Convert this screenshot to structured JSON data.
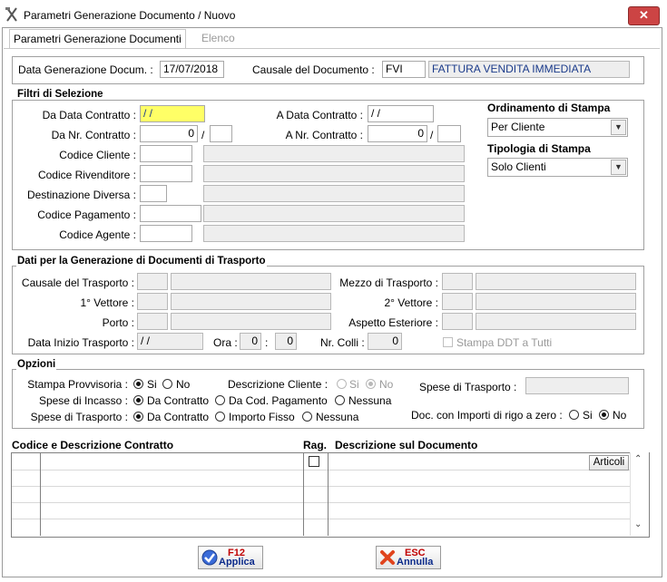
{
  "window": {
    "title": "Parametri Generazione Documento / Nuovo",
    "close_label": "✕"
  },
  "tabs": [
    "Parametri Generazione Documenti",
    "Elenco"
  ],
  "header": {
    "data_gen_label": "Data Generazione Docum. :",
    "data_gen_value": "17/07/2018",
    "causale_label": "Causale del Documento :",
    "causale_code": "FVI",
    "causale_desc": "FATTURA VENDITA IMMEDIATA"
  },
  "filtri": {
    "title": "Filtri di Selezione",
    "da_data_label": "Da Data Contratto :",
    "da_data_value": "/ /",
    "a_data_label": "A Data Contratto :",
    "a_data_value": "/ /",
    "da_nr_label": "Da Nr. Contratto :",
    "da_nr_value": "0",
    "a_nr_label": "A Nr. Contratto :",
    "a_nr_value": "0",
    "slash": "/",
    "codice_cliente_label": "Codice Cliente :",
    "codice_rivenditore_label": "Codice Rivenditore :",
    "destinazione_label": "Destinazione Diversa :",
    "codice_pagamento_label": "Codice Pagamento :",
    "codice_agente_label": "Codice Agente :",
    "ordinamento_label": "Ordinamento di Stampa",
    "ordinamento_value": "Per Cliente",
    "tipologia_label": "Tipologia di Stampa",
    "tipologia_value": "Solo Clienti"
  },
  "trasporto": {
    "title": "Dati per la Generazione di Documenti di Trasporto",
    "causale_label": "Causale del Trasporto :",
    "vettore1_label": "1° Vettore :",
    "porto_label": "Porto :",
    "mezzo_label": "Mezzo di Trasporto :",
    "vettore2_label": "2° Vettore :",
    "aspetto_label": "Aspetto Esteriore :",
    "data_inizio_label": "Data Inizio Trasporto :",
    "data_inizio_value": "/ /",
    "ora_label": "Ora :",
    "ora_h": "0",
    "ora_sep": ":",
    "ora_m": "0",
    "colli_label": "Nr. Colli :",
    "colli_value": "0",
    "stampa_ddt_label": "Stampa DDT a Tutti"
  },
  "opzioni": {
    "title": "Opzioni",
    "stampa_prov_label": "Stampa Provvisoria :",
    "si": "Si",
    "no": "No",
    "descr_cliente_label": "Descrizione Cliente :",
    "spese_trasp_label": "Spese di Trasporto :",
    "spese_incasso_label": "Spese di Incasso :",
    "da_contratto": "Da Contratto",
    "da_cod_pag": "Da Cod. Pagamento",
    "nessuna": "Nessuna",
    "spese_trasporto2_label": "Spese di Trasporto :",
    "importo_fisso": "Importo Fisso",
    "doc_importi_label": "Doc. con Importi di rigo a zero :"
  },
  "grid": {
    "col1": "Codice e Descrizione Contratto",
    "col2": "Rag.",
    "col3": "Descrizione sul Documento",
    "articoli_button": "Articoli"
  },
  "actions": {
    "apply_key": "F12",
    "apply_label": "Applica",
    "cancel_key": "ESC",
    "cancel_label": "Annulla"
  }
}
